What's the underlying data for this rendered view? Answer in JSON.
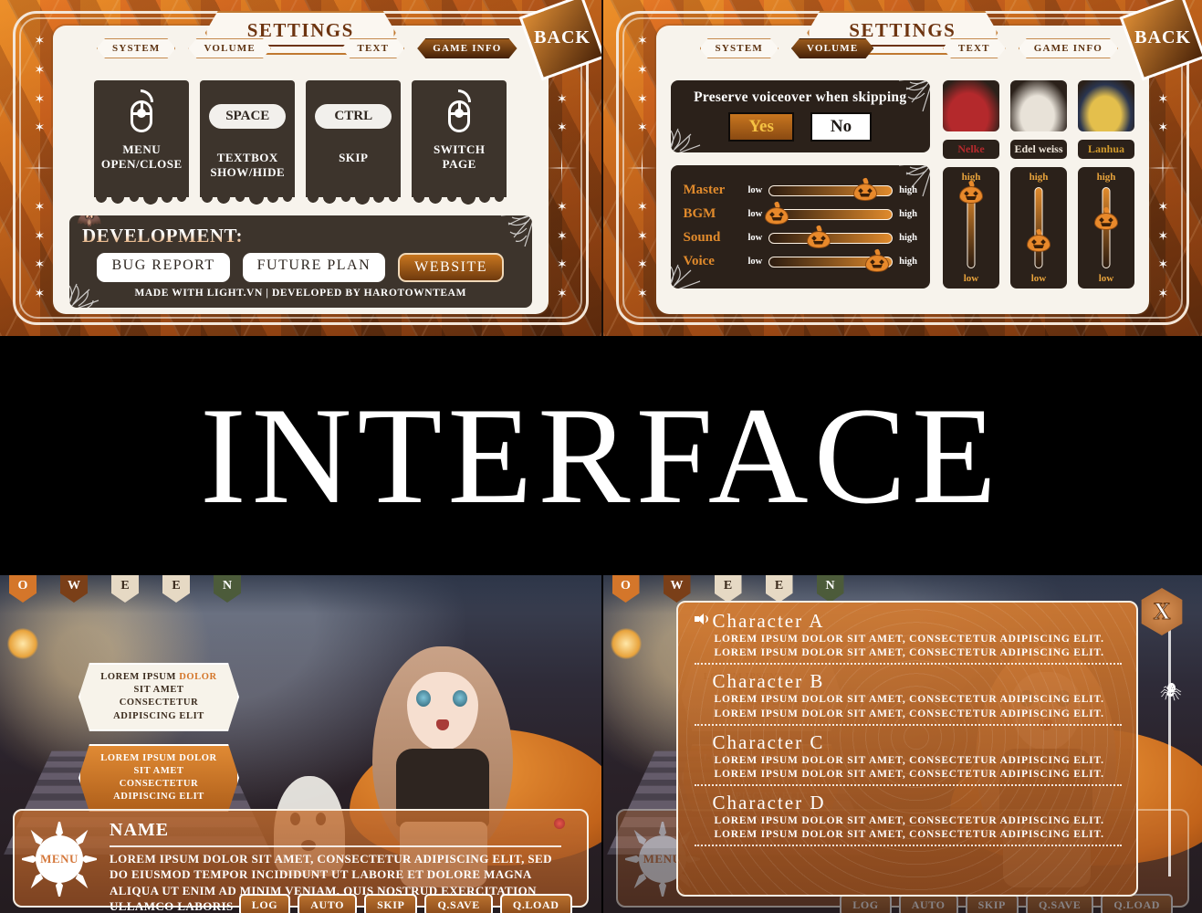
{
  "settings": {
    "title": "SETTINGS",
    "back_label": "BACK",
    "tabs_left": [
      {
        "label": "SYSTEM",
        "active_left": false,
        "active_right": false
      },
      {
        "label": "VOLUME",
        "active_left": false,
        "active_right": true
      }
    ],
    "tabs_right": [
      {
        "label": "TEXT",
        "active_left": false,
        "active_right": false
      },
      {
        "label": "GAME INFO",
        "active_left": true,
        "active_right": false
      }
    ],
    "game_info": {
      "controls": [
        {
          "icon": "mouse-icon",
          "key": "",
          "label": "MENU\nOPEN/CLOSE"
        },
        {
          "icon": "key-pill",
          "key": "SPACE",
          "label": "TEXTBOX\nSHOW/HIDE"
        },
        {
          "icon": "key-pill",
          "key": "CTRL",
          "label": "SKIP"
        },
        {
          "icon": "mouse-icon",
          "key": "",
          "label": "SWITCH PAGE"
        }
      ],
      "development": {
        "title": "DEVELOPMENT:",
        "buttons": [
          {
            "label": "BUG REPORT",
            "accent": false
          },
          {
            "label": "FUTURE PLAN",
            "accent": false
          },
          {
            "label": "WEBSITE",
            "accent": true
          }
        ],
        "footer": "MADE WITH LIGHT.VN | DEVELOPED BY HAROTOWNTEAM"
      }
    },
    "volume": {
      "preserve_label": "Preserve voiceover when skipping",
      "yes_label": "Yes",
      "no_label": "No",
      "selected": "Yes",
      "low_label": "low",
      "high_label": "high",
      "sliders": [
        {
          "name": "Master",
          "value": 78
        },
        {
          "name": "BGM",
          "value": 6
        },
        {
          "name": "Sound",
          "value": 40
        },
        {
          "name": "Voice",
          "value": 88
        }
      ],
      "characters": [
        {
          "name": "Nelke",
          "color": "#b4292c",
          "value": 95
        },
        {
          "name": "Edel weiss",
          "color": "#efe6da",
          "value": 42
        },
        {
          "name": "Lanhua",
          "color": "#d19a2c",
          "value": 68
        }
      ]
    }
  },
  "interface_banner": {
    "title": "INTERFACE"
  },
  "scene": {
    "bunting_letters": [
      "O",
      "W",
      "E",
      "E",
      "N"
    ],
    "choices": [
      {
        "line1_a": "LOREM IPSUM ",
        "line1_b": "DOLOR",
        "line2": "SIT AMET CONSECTETUR",
        "line3": "ADIPISCING ELIT"
      },
      {
        "line1_a": "LOREM IPSUM DOLOR",
        "line1_b": "",
        "line2": "SIT AMET CONSECTETUR",
        "line3": "ADIPISCING ELIT"
      }
    ],
    "dialogue": {
      "menu_label": "MENU",
      "speaker": "NAME",
      "text": "LOREM IPSUM DOLOR SIT AMET, CONSECTETUR ADIPISCING ELIT, SED DO EIUSMOD TEMPOR INCIDIDUNT UT LABORE ET DOLORE MAGNA ALIQUA UT ENIM AD MINIM VENIAM, QUIS NOSTRUD EXERCITATION ULLAMCO LABORIS",
      "buttons": [
        "LOG",
        "AUTO",
        "SKIP",
        "Q.SAVE",
        "Q.LOAD"
      ]
    }
  },
  "backlog": {
    "close_label": "X",
    "body_line": "LOREM IPSUM DOLOR SIT AMET, CONSECTETUR ADIPISCING ELIT.",
    "entries": [
      {
        "speaker": "Character A",
        "has_voice": true,
        "line1": "LOREM IPSUM DOLOR SIT AMET, CONSECTETUR ADIPISCING ELIT.",
        "line2": "LOREM IPSUM DOLOR SIT AMET, CONSECTETUR ADIPISCING ELIT."
      },
      {
        "speaker": "Character B",
        "has_voice": false,
        "line1": "LOREM IPSUM DOLOR SIT AMET, CONSECTETUR ADIPISCING ELIT.",
        "line2": "LOREM IPSUM DOLOR SIT AMET, CONSECTETUR ADIPISCING ELIT."
      },
      {
        "speaker": "Character C",
        "has_voice": false,
        "line1": "LOREM IPSUM DOLOR SIT AMET, CONSECTETUR ADIPISCING ELIT.",
        "line2": "LOREM IPSUM DOLOR SIT AMET, CONSECTETUR ADIPISCING ELIT."
      },
      {
        "speaker": "Character D",
        "has_voice": false,
        "line1": "LOREM IPSUM DOLOR SIT AMET, CONSECTETUR ADIPISCING ELIT.",
        "line2": "LOREM IPSUM DOLOR SIT AMET, CONSECTETUR ADIPISCING ELIT."
      }
    ]
  },
  "colors": {
    "accent_orange": "#d4762a",
    "dark_brown": "#3d342c",
    "cream": "#f7f3ec",
    "deep_brown": "#2b211a"
  }
}
